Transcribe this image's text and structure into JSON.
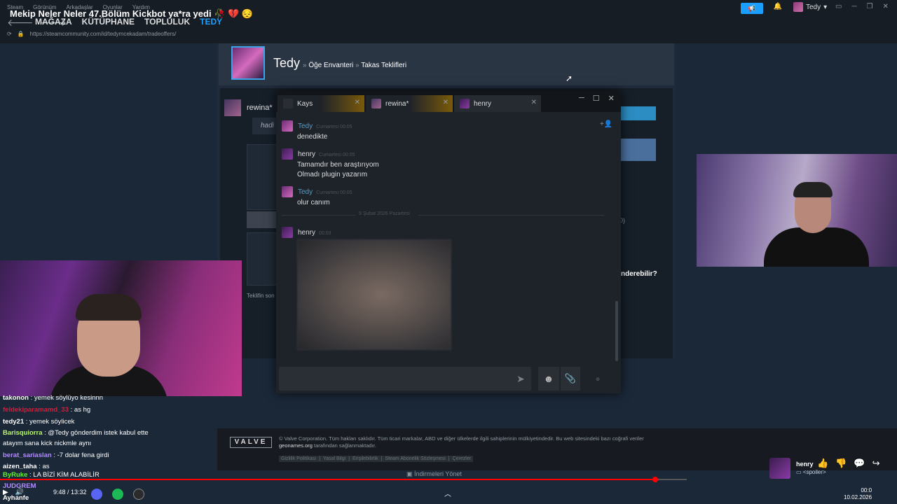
{
  "video_title": "Mekip Neler Neler 47.Bölüm Kickbot ya*ra yedi 🥀 💔 😔",
  "steam_menu": [
    "Steam",
    "Görünüm",
    "Arkadaşlar",
    "Oyunlar",
    "Yardım"
  ],
  "main_nav": [
    "MAĞAZA",
    "KÜTÜPHANE",
    "TOPLULUK",
    "TEDY"
  ],
  "url": "https://steamcommunity.com/id/tedymcekadam/tradeoffers/",
  "user_menu_name": "Tedy",
  "profile": {
    "name": "Tedy",
    "breadcrumb": [
      "Öğe Envanteri",
      "Takas Teklifleri"
    ]
  },
  "trade": {
    "partner": "rewina*",
    "message": "hadi",
    "footer_note": "Teklifin son",
    "right_partial_count": "0)",
    "right_partial_question": "nderebilir?"
  },
  "chat": {
    "tabs": [
      {
        "name": "Kays",
        "color": "#f4b400"
      },
      {
        "name": "rewina*",
        "color": "#f4b400"
      },
      {
        "name": "henry",
        "color": "#262a31"
      }
    ],
    "messages": [
      {
        "author": "Tedy",
        "time": "Cumartesi 00:05",
        "lines": [
          "denedikte"
        ],
        "color": "#5f9bbf"
      },
      {
        "author": "henry",
        "time": "Cumartesi 00:05",
        "lines": [
          "Tamamdır ben araştırıyom",
          "Olmadı plugin yazarım"
        ],
        "color": "#dcdedf"
      },
      {
        "author": "Tedy",
        "time": "Cumartesi 00:05",
        "lines": [
          "olur canım"
        ],
        "color": "#5f9bbf"
      },
      {
        "author": "henry",
        "time": "00:03",
        "lines": [],
        "color": "#dcdedf"
      }
    ],
    "date_divider": "9 Şubat 2026 Pazartesi",
    "input_value": ""
  },
  "stream_chat": [
    {
      "user": "takonon",
      "text": ": yemek söylüyo kesinnn",
      "color": "#ffffff"
    },
    {
      "user": "feldekiparamamd_33",
      "text": ": as hg",
      "color": "#d21f3c"
    },
    {
      "user": "tedy21",
      "text": ": yemek söylicek",
      "color": "#ffffff"
    },
    {
      "user": "Barisquiorra",
      "text": ": @Tedy gönderdim istek kabul ette",
      "color": "#b9f56b"
    },
    {
      "user": "",
      "text": "atayım sana kick nickmle aynı",
      "color": "#ffffff"
    },
    {
      "user": "berat_sariaslan",
      "text": ": -7 dolar fena girdi",
      "color": "#b28bff"
    },
    {
      "user": "aizen_taha",
      "text": ": as",
      "color": "#ffffff"
    },
    {
      "user": "ByRuke",
      "text": ": LA BİZİ KİM ALABİLİR",
      "color": "#53fc18"
    },
    {
      "user": "JUDGREM",
      "text": "",
      "color": "#b28bff"
    },
    {
      "user": "Ayhanfe",
      "text": "",
      "color": "#ffffff"
    }
  ],
  "footer": {
    "logo": "VALVE",
    "legal_line1": "© Valve Corporation. Tüm hakları saklıdır. Tüm ticari markalar, ABD ve diğer ülkelerde ilgili sahiplerinin mülkiyetindedir. Bu web sitesindeki bazı coğrafi veriler",
    "legal_line2_link": "geonames.org",
    "legal_line2_rest": " tarafından sağlanmaktadır.",
    "links": [
      "Gizlilik Politikası",
      "|",
      "Yasal Bilgi",
      "|",
      "Erişilebilirlik",
      "|",
      "Steam Abonelik Sözleşmesi",
      "|",
      "Çerezler"
    ],
    "downloads": "İndirmeleri Yönet"
  },
  "player": {
    "time": "9:48 / 13:32",
    "progress": 0.954
  },
  "card": {
    "name": "henry",
    "sub": "<spoiler>"
  },
  "clock": {
    "time": "00:0",
    "date": "10.02.2026"
  }
}
